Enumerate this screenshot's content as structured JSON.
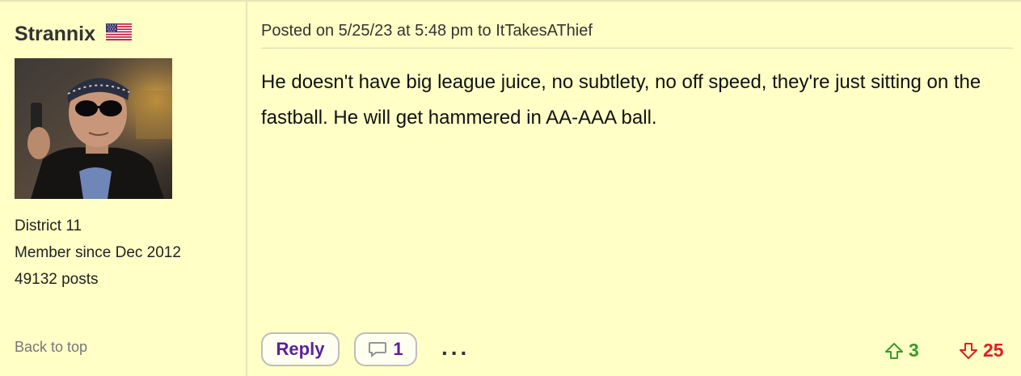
{
  "user": {
    "name": "Strannix",
    "location": "District 11",
    "member_since": "Member since Dec 2012",
    "posts": "49132 posts",
    "back_to_top": "Back to top"
  },
  "post": {
    "posted_line": "Posted on 5/25/23 at 5:48 pm to ItTakesAThief",
    "body": "He doesn't have big league juice, no subtlety, no off speed, they're just sitting on the fastball. He will get hammered in AA-AAA ball."
  },
  "actions": {
    "reply_label": "Reply",
    "comment_count": "1",
    "more_label": "...",
    "upvotes": "3",
    "downvotes": "25"
  },
  "colors": {
    "background": "#ffffc6",
    "accent_purple": "#5b1fa0",
    "upvote_green": "#3a9a2a",
    "downvote_red": "#e02020"
  },
  "icons": {
    "flag": "us-flag-icon",
    "comment": "speech-bubble-icon",
    "upvote": "arrow-up-icon",
    "downvote": "arrow-down-icon"
  }
}
